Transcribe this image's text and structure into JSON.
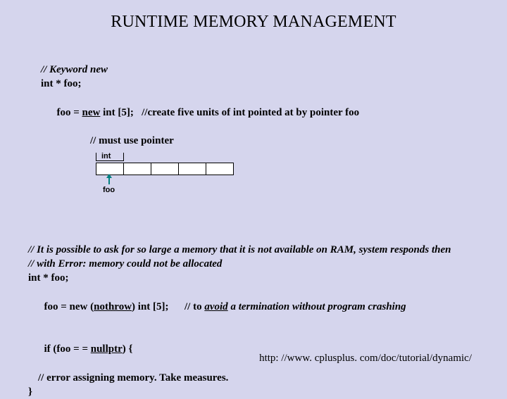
{
  "title": "RUNTIME MEMORY MANAGEMENT",
  "block1": {
    "l1": "// Keyword new",
    "l2": "int * foo;",
    "l3a": "foo = ",
    "l3b": "new",
    "l3c": " int [5];   //create five units of int pointed at by pointer foo",
    "l4": "// must use pointer"
  },
  "diagram": {
    "int": "int",
    "foo": "foo"
  },
  "block2": {
    "l1": "// It is possible to ask for so large a memory that it is not available on RAM, system responds then",
    "l2": "// with Error: memory could not be allocated",
    "l3": "int * foo;",
    "l4a": "foo = new (",
    "l4b": "nothrow",
    "l4c": ") int [5];      // to ",
    "l4d": "avoid",
    "l4e": " a termination without program crashing",
    "l5a": "if (foo = = ",
    "l5b": "nullptr",
    "l5c": ") {",
    "l6": "// error assigning memory. Take measures.",
    "l7": "}"
  },
  "url": "http: //www. cplusplus. com/doc/tutorial/dynamic/"
}
